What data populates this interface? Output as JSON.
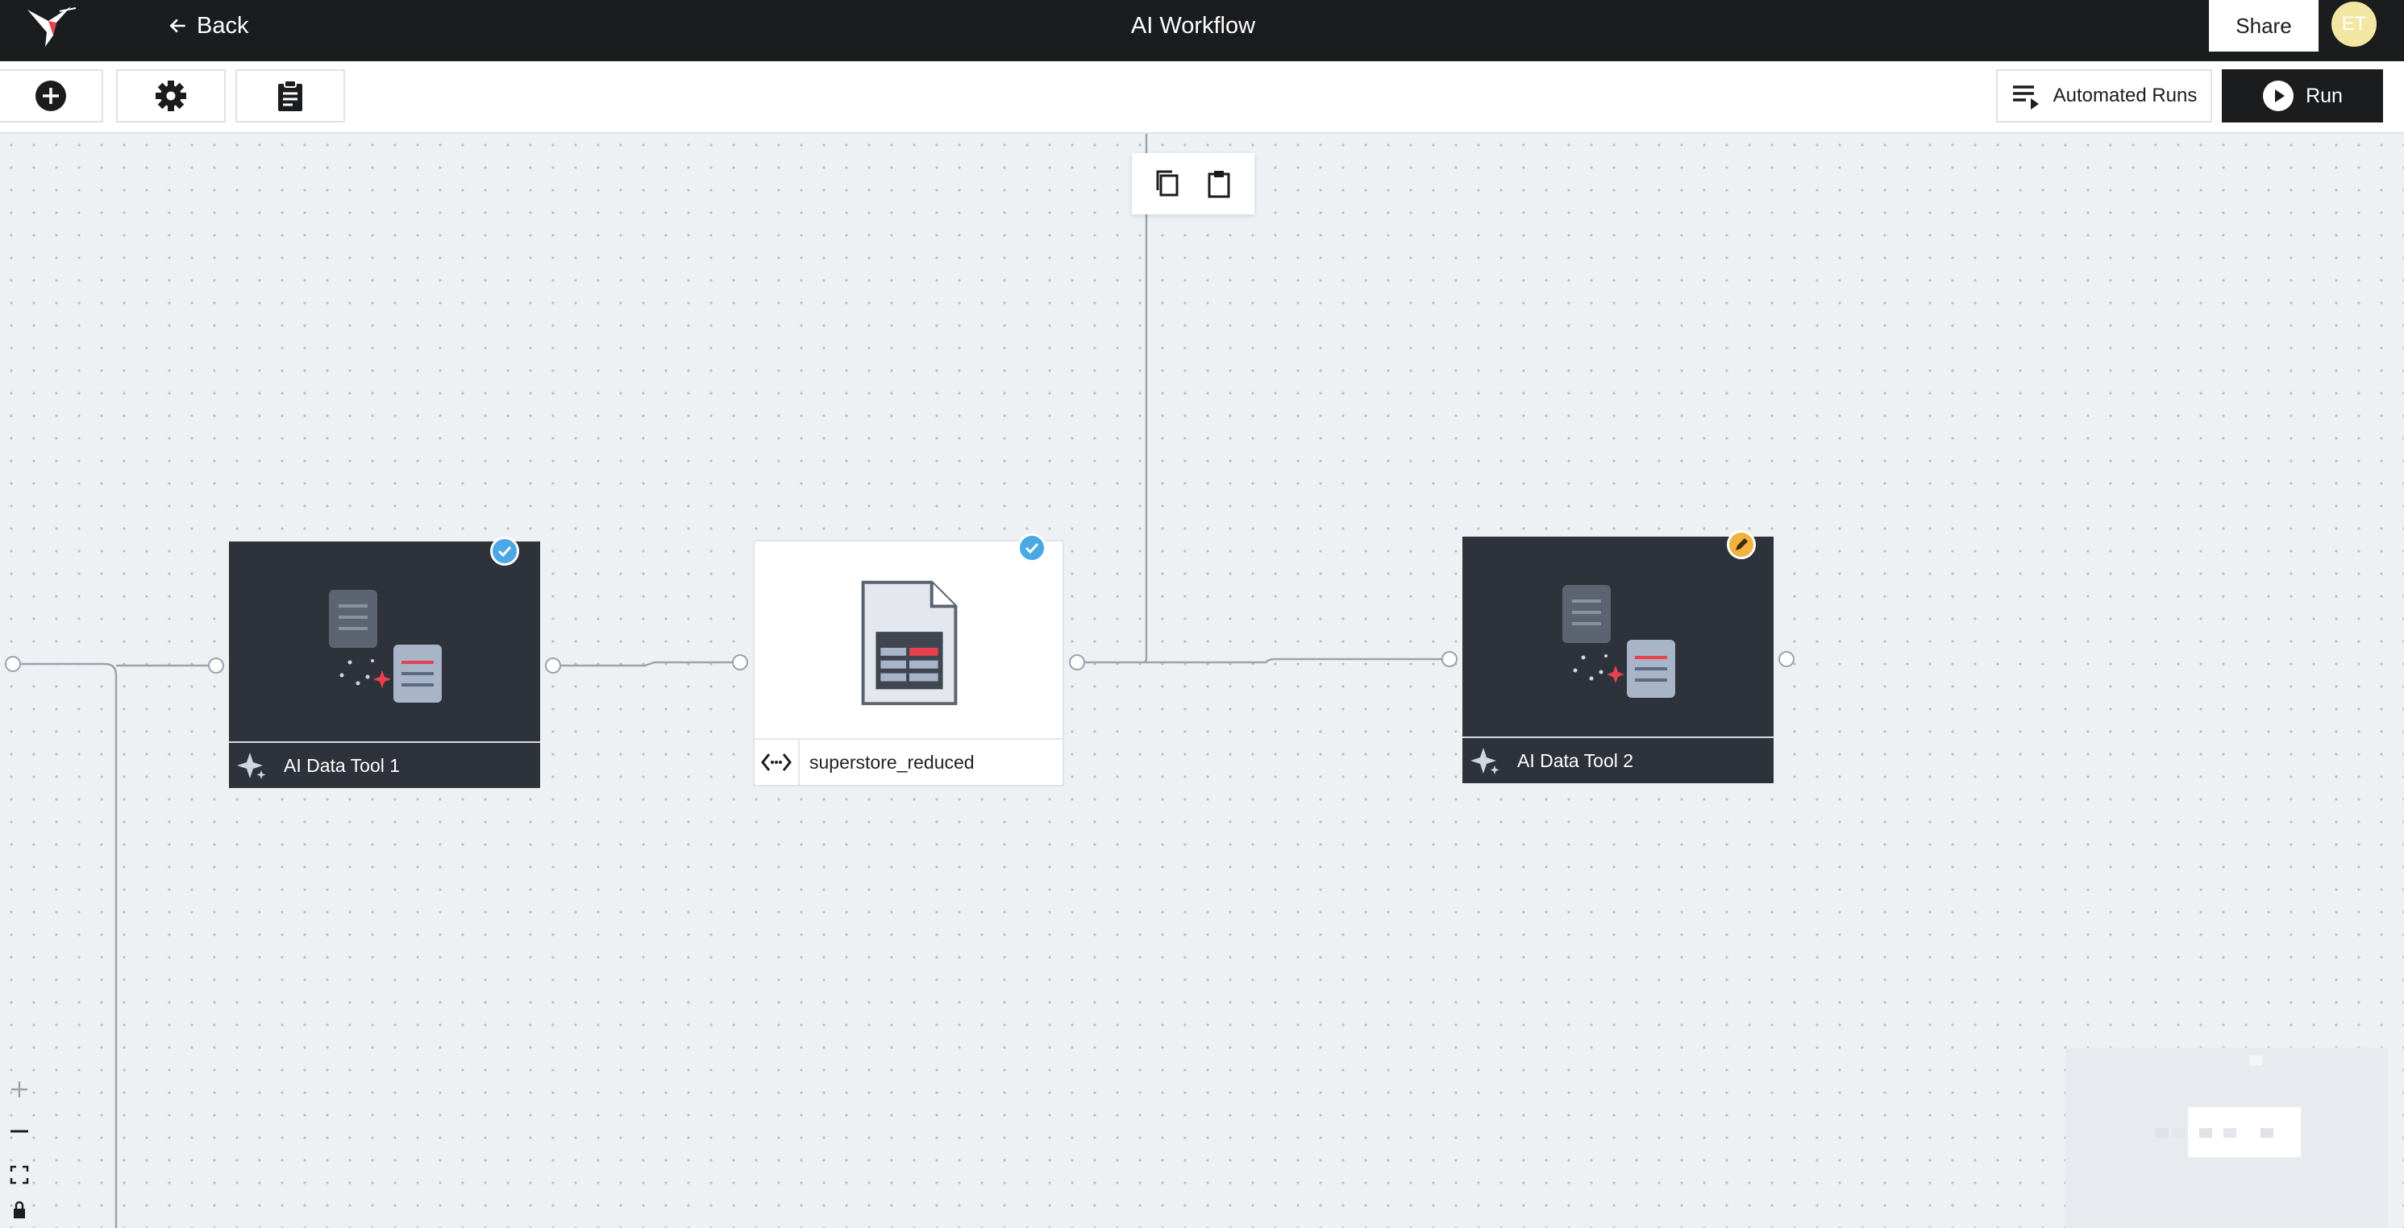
{
  "topbar": {
    "back_label": "Back",
    "title": "AI Workflow",
    "share_label": "Share",
    "avatar_initials": "ET"
  },
  "toolbar": {
    "automated_runs_label": "Automated Runs",
    "run_label": "Run"
  },
  "nodes": {
    "ai_tool_1": {
      "label": "AI Data Tool 1",
      "status": "completed"
    },
    "dataset": {
      "label": "superstore_reduced",
      "status": "completed"
    },
    "ai_tool_2": {
      "label": "AI Data Tool 2",
      "status": "editing"
    }
  },
  "colors": {
    "topbar": "#1b1c1e",
    "node_dark": "#2e333b",
    "badge_ok": "#4aa8e4",
    "badge_edit": "#f2b23e",
    "accent_red": "#e8414f",
    "avatar": "#f2e7a2"
  },
  "icons": [
    "hummingbird-logo-icon",
    "arrow-left-icon",
    "plus-circle-icon",
    "gear-icon",
    "clipboard-icon",
    "playlist-icon",
    "play-circle-icon",
    "copy-icon",
    "paste-icon",
    "sparkle-icon",
    "code-brackets-icon",
    "check-icon",
    "pencil-icon",
    "zoom-in-icon",
    "zoom-out-icon",
    "fit-view-icon",
    "lock-icon"
  ]
}
